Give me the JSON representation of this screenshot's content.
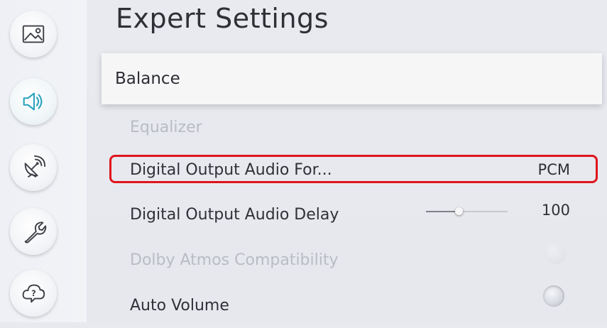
{
  "page": {
    "title": "Expert Settings"
  },
  "sidebar": {
    "items": [
      {
        "icon": "picture-icon",
        "active": false
      },
      {
        "icon": "sound-icon",
        "active": true
      },
      {
        "icon": "broadcast-icon",
        "active": false
      },
      {
        "icon": "wrench-icon",
        "active": false
      },
      {
        "icon": "support-icon",
        "active": false
      }
    ]
  },
  "settings": {
    "balance": {
      "label": "Balance"
    },
    "equalizer": {
      "label": "Equalizer"
    },
    "digital_output_format": {
      "label": "Digital Output Audio For...",
      "value": "PCM"
    },
    "digital_output_delay": {
      "label": "Digital Output Audio Delay",
      "value": "100",
      "level_fraction": 0.4
    },
    "dolby_atmos": {
      "label": "Dolby Atmos Compatibility"
    },
    "auto_volume": {
      "label": "Auto Volume"
    }
  },
  "colors": {
    "highlight": "#e0141c",
    "accent": "#2aa3bd"
  }
}
